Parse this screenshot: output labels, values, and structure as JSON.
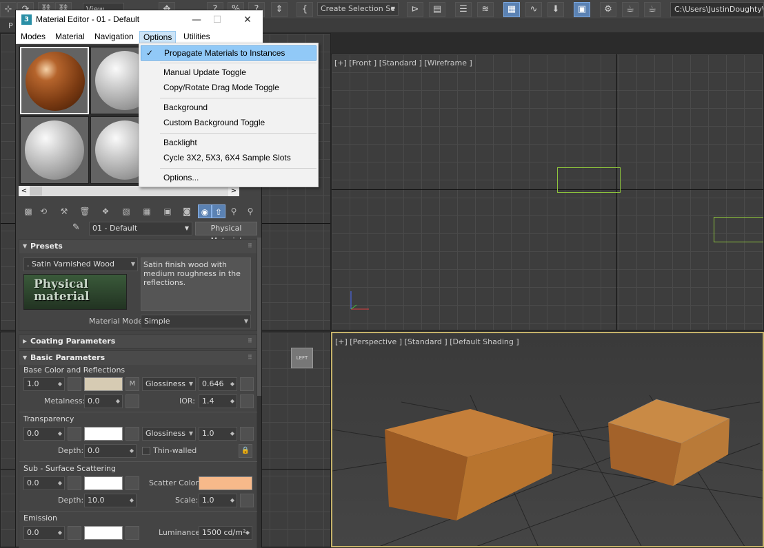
{
  "toolbar": {
    "view_dropdown": "View",
    "selection_set_dropdown": "Create Selection Se",
    "path": "C:\\Users\\JustinDoughty\\Do"
  },
  "command_strip": {
    "label": "P"
  },
  "viewports": {
    "front": {
      "label": "[+] [Front ] [Standard ] [Wireframe ]"
    },
    "perspective": {
      "label": "[+] [Perspective ] [Standard ] [Default Shading ]"
    },
    "viewcube_left_label": "LEFT"
  },
  "material_editor": {
    "title_icon": "3",
    "title": "Material Editor - 01 - Default",
    "menus": [
      "Modes",
      "Material",
      "Navigation",
      "Options",
      "Utilities"
    ],
    "material_name": "01 - Default",
    "material_type": "Physical Material",
    "presets": {
      "header": "Presets",
      "preset_value": ".  Satin Varnished Wood",
      "description": "Satin finish wood with medium roughness in the reflections.",
      "logo_text": "Physical material",
      "mode_label": "Material Mode:",
      "mode_value": "Simple"
    },
    "coating": {
      "header": "Coating Parameters"
    },
    "basic": {
      "header": "Basic Parameters",
      "base_section": "Base Color and Reflections",
      "base_weight": "1.0",
      "base_color": "#d6cbb3",
      "m_button": "M",
      "reflect_mode": "Glossiness",
      "glossiness": "0.646",
      "metalness_label": "Metalness:",
      "metalness": "0.0",
      "ior_label": "IOR:",
      "ior": "1.4",
      "transparency_section": "Transparency",
      "transparency_weight": "0.0",
      "transparency_color": "#ffffff",
      "transparency_mode": "Glossiness",
      "transparency_gloss": "1.0",
      "depth_label": "Depth:",
      "transparency_depth": "0.0",
      "thin_walled_label": "Thin-walled",
      "sss_section": "Sub - Surface Scattering",
      "sss_weight": "0.0",
      "sss_color": "#ffffff",
      "scatter_color_label": "Scatter Color:",
      "scatter_color": "#f7b98a",
      "sss_depth": "10.0",
      "scale_label": "Scale:",
      "sss_scale": "1.0",
      "emission_section": "Emission",
      "emission_weight": "0.0",
      "emission_color": "#ffffff",
      "luminance_label": "Luminance:",
      "luminance": "1500 cd/m²"
    }
  },
  "options_menu": {
    "items": [
      {
        "label": "Propagate Materials to Instances",
        "checked": true
      },
      {
        "label": "Manual Update Toggle"
      },
      {
        "label": "Copy/Rotate Drag Mode Toggle"
      },
      {
        "label": "Background"
      },
      {
        "label": "Custom Background Toggle"
      },
      {
        "label": "Backlight"
      },
      {
        "label": "Cycle 3X2, 5X3, 6X4 Sample Slots"
      },
      {
        "label": "Options..."
      }
    ]
  },
  "colors": {
    "accent_blue": "#5b82b3",
    "selection_green": "#8fc63c",
    "active_viewport": "#c5b26a",
    "wood": "#b8742e"
  }
}
